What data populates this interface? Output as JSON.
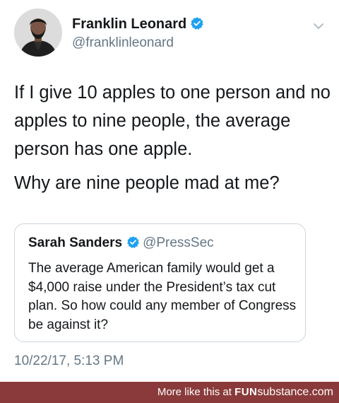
{
  "tweet": {
    "author": {
      "name": "Franklin Leonard",
      "handle": "@franklinleonard",
      "verified": true
    },
    "text": [
      "If I give 10 apples to one person and no apples to nine people, the average person has one apple.",
      "Why are nine people mad at me?"
    ],
    "quoted_tweet": {
      "name": "Sarah Sanders",
      "handle": "@PressSec",
      "verified": true,
      "text": "The average American family would get a $4,000 raise under the President’s tax cut plan. So how could any member of Congress be against it?"
    },
    "timestamp": "10/22/17, 5:13 PM"
  },
  "footer": {
    "prefix": "More like this at",
    "brand_bold": "FUN",
    "brand_rest": "substance.com",
    "background": "#8a3a3a"
  },
  "icons": {
    "verified": "verified-badge-icon",
    "menu": "chevron-down-icon"
  },
  "colors": {
    "verified_blue": "#1da1f2",
    "secondary_text": "#657786",
    "border": "#ccd6dd"
  }
}
